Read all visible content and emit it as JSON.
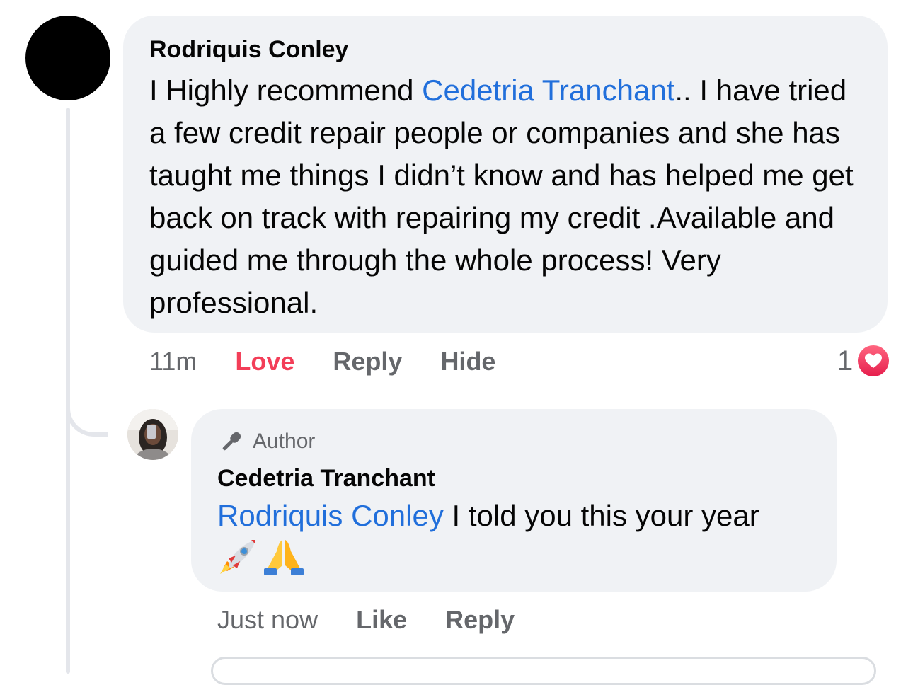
{
  "comment": {
    "author": "Rodriquis Conley",
    "text_before_mention": "I Highly recommend ",
    "mention": "Cedetria Tranchant",
    "text_after_mention": ".. I have tried a few credit repair people or companies and she has taught me things I didn’t know and has helped me get back on track with repairing my credit .Available and guided me through the whole process! Very professional.",
    "time": "11m",
    "actions": {
      "love": "Love",
      "reply": "Reply",
      "hide": "Hide"
    },
    "reaction_count": "1",
    "reaction_icon": "love-heart-icon",
    "colors": {
      "love_action": "#f33e58",
      "mention": "#216fdb",
      "bubble": "#f0f2f5"
    }
  },
  "reply": {
    "badge_label": "Author",
    "badge_icon": "microphone-icon",
    "author": "Cedetria Tranchant",
    "mention": "Rodriquis Conley",
    "text_after_mention": " I told you this your year",
    "emojis": [
      "rocket-emoji",
      "folded-hands-emoji"
    ],
    "time": "Just now",
    "actions": {
      "like": "Like",
      "reply": "Reply"
    }
  }
}
